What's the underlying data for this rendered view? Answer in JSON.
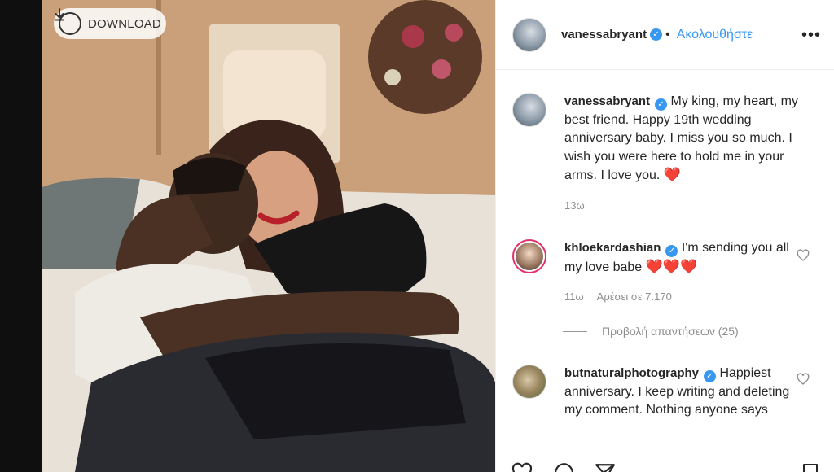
{
  "download": {
    "label": "DOWNLOAD",
    "icon": "download-icon"
  },
  "post": {
    "author": "vanessabryant",
    "follow_label": "Ακολουθήστε",
    "more_icon": "more-options-icon"
  },
  "caption": {
    "username": "vanessabryant",
    "text": "My king, my heart, my best friend. Happy 19th wedding anniversary baby. I miss you so much. I wish you were here to hold me in your arms. I love you.",
    "heart": "❤️",
    "time": "13ω"
  },
  "comments": [
    {
      "username": "khloekardashian",
      "text": "I'm sending you all my love babe",
      "hearts": "❤️❤️❤️",
      "time": "11ω",
      "likes": "Αρέσει σε 7.170",
      "view_replies": "Προβολή απαντήσεων (25)"
    },
    {
      "username": "butnaturalphotography",
      "text": "Happiest anniversary. I keep writing and deleting my comment. Nothing anyone says"
    }
  ],
  "colors": {
    "accent": "#3897f0",
    "heart": "#ed4956",
    "muted": "#8e8e8e"
  }
}
